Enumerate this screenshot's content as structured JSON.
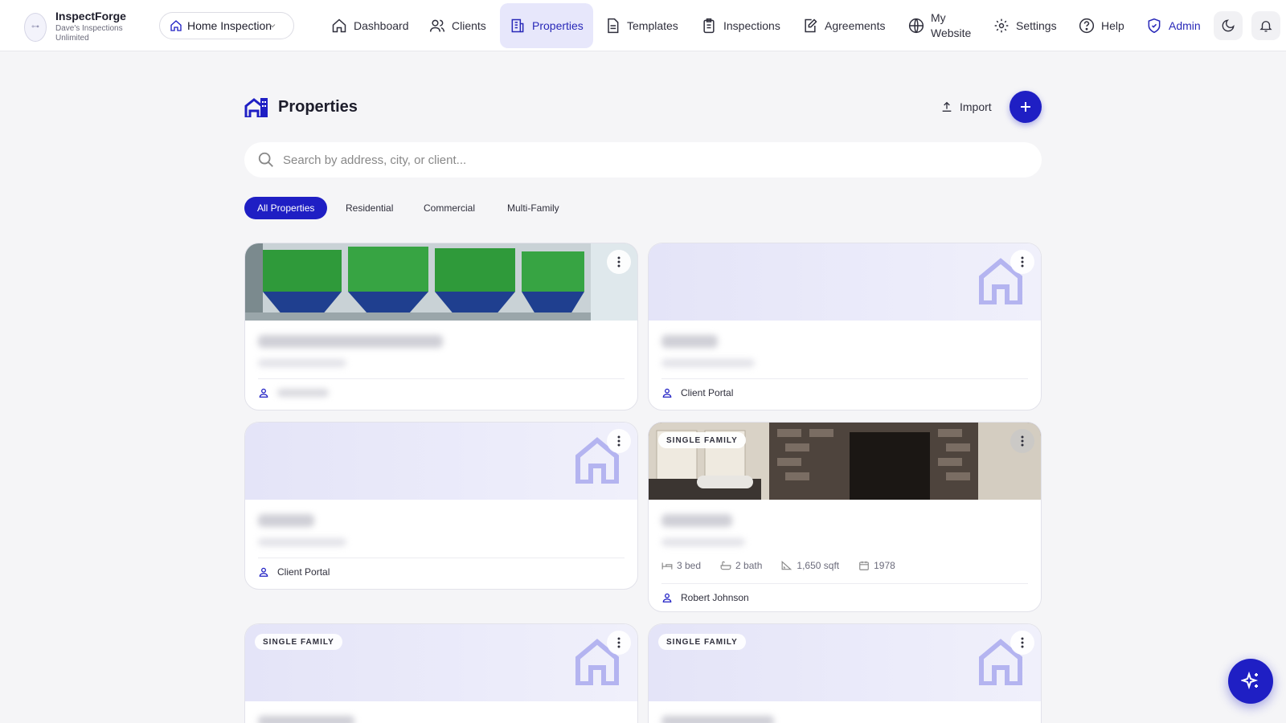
{
  "app": {
    "name": "InspectForge",
    "company": "Dave's Inspections Unlimited"
  },
  "selector": {
    "label": "Home Inspection"
  },
  "nav": {
    "dashboard": "Dashboard",
    "clients": "Clients",
    "properties": "Properties",
    "templates": "Templates",
    "inspections": "Inspections",
    "agreements": "Agreements",
    "website_line1": "My",
    "website_line2": "Website",
    "settings": "Settings",
    "help": "Help",
    "admin": "Admin"
  },
  "page": {
    "title": "Properties",
    "import_label": "Import"
  },
  "search": {
    "placeholder": "Search by address, city, or client..."
  },
  "filters": [
    "All Properties",
    "Residential",
    "Commercial",
    "Multi-Family"
  ],
  "cards": [
    {
      "client": "",
      "badge": ""
    },
    {
      "client": "Client Portal",
      "badge": ""
    },
    {
      "client": "Client Portal",
      "badge": ""
    },
    {
      "client": "Robert Johnson",
      "badge": "SINGLE FAMILY",
      "beds": "3 bed",
      "baths": "2 bath",
      "sqft": "1,650 sqft",
      "year": "1978"
    },
    {
      "client": "",
      "badge": "SINGLE FAMILY"
    },
    {
      "client": "",
      "badge": "SINGLE FAMILY"
    }
  ],
  "colors": {
    "accent": "#1f1fc4",
    "active_nav_bg": "#e7e7fb",
    "placeholder_bg": "#e4e4f8"
  }
}
